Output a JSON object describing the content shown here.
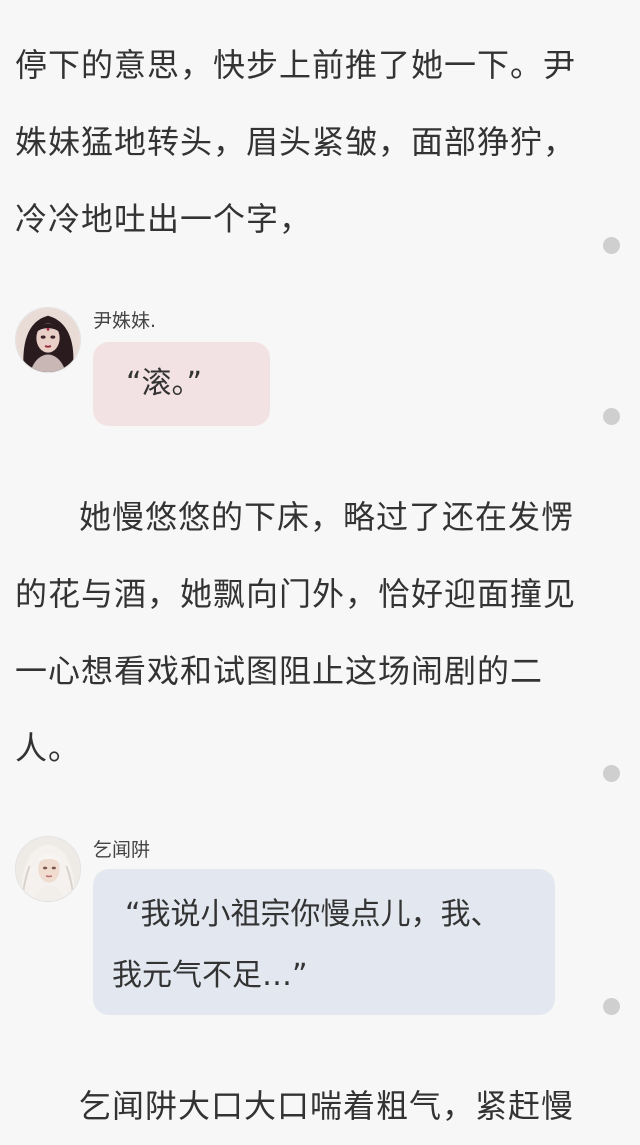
{
  "colors": {
    "background": "#f7f7f7",
    "text": "#333333",
    "scroll_dot": "#cfcfcf",
    "bubble_pink": "#f2e2e4",
    "bubble_blue": "#e3e8f0"
  },
  "paragraphs": [
    {
      "lines": [
        "停下的意思，快步上前推了她一下。尹",
        "姝妹猛地转头，眉头紧皱，面部狰狞，",
        "冷冷地吐出一个字，"
      ]
    },
    {
      "lines": [
        "她慢悠悠的下床，略过了还在发愣",
        "的花与酒，她飘向门外，恰好迎面撞见",
        "一心想看戏和试图阻止这场闹剧的二",
        "人。"
      ]
    },
    {
      "lines": [
        "乞闻阱大口大口喘着粗气，紧赶慢"
      ]
    }
  ],
  "dialogues": [
    {
      "speaker": "尹姝妹.",
      "avatar_icon": "avatar-dark-hair-doll-icon",
      "bubble_color": "#f2e2e4",
      "lines": [
        "“滚。”"
      ]
    },
    {
      "speaker": "乞闻阱",
      "avatar_icon": "avatar-white-hair-doll-icon",
      "bubble_color": "#e3e8f0",
      "lines": [
        "“我说小祖宗你慢点儿，我、",
        "我元气不足…”"
      ]
    }
  ]
}
